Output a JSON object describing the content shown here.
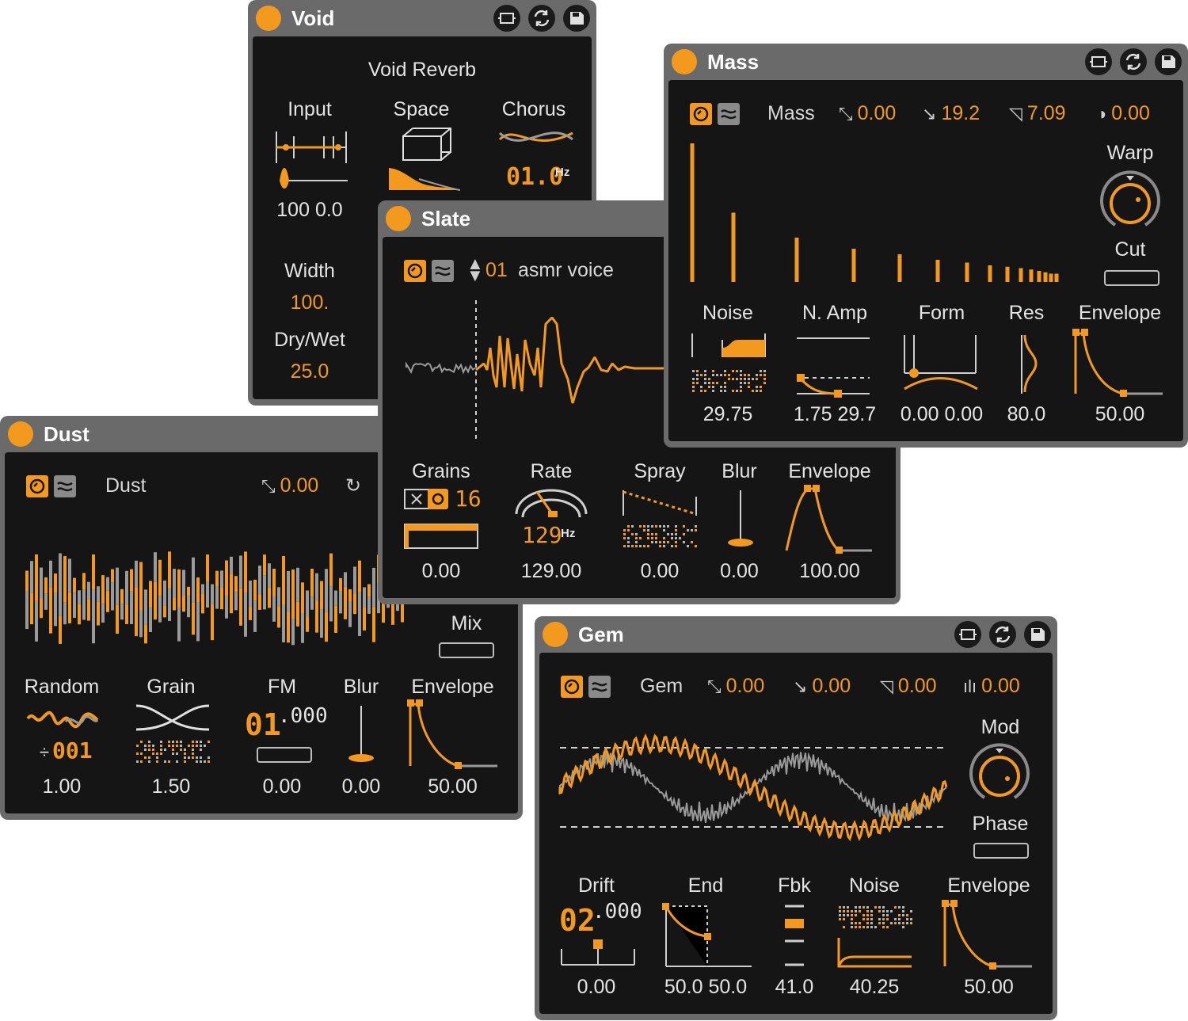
{
  "accent": "#f39a1e",
  "title_buttons": [
    "fold-icon",
    "swap-icon",
    "save-icon"
  ],
  "void": {
    "title": "Void",
    "subtitle": "Void Reverb",
    "labels": {
      "input": "Input",
      "space": "Space",
      "chorus": "Chorus",
      "width": "Width",
      "drywet": "Dry/Wet"
    },
    "input_value": "100 0.0",
    "chorus_rate": "01.0",
    "chorus_unit": "Hz",
    "width_value": "100.",
    "drywet_value": "25.0"
  },
  "mass": {
    "title": "Mass",
    "name": "Mass",
    "params": [
      "0.00",
      "19.2",
      "7.09",
      "0.00"
    ],
    "param_icons": [
      "pitch-icon",
      "decay-icon",
      "attack-icon",
      "contrast-icon"
    ],
    "warp_label": "Warp",
    "cut_label": "Cut",
    "partials": [
      1.0,
      0.5,
      0.32,
      0.24,
      0.2,
      0.16,
      0.14,
      0.12,
      0.11,
      0.1,
      0.09,
      0.08,
      0.07,
      0.06,
      0.06
    ],
    "labels": {
      "noise": "Noise",
      "namp": "N. Amp",
      "form": "Form",
      "res": "Res",
      "envelope": "Envelope"
    },
    "values": {
      "noise": "29.75",
      "namp": "1.75 29.7",
      "form": "0.00 0.00",
      "res": "80.0",
      "envelope": "50.00"
    }
  },
  "slate": {
    "title": "Slate",
    "preset_number": "01",
    "preset_name": "asmr voice",
    "labels": {
      "grains": "Grains",
      "rate": "Rate",
      "spray": "Spray",
      "blur": "Blur",
      "envelope": "Envelope"
    },
    "grains_count": "16",
    "rate_display": "129",
    "rate_unit": "Hz",
    "values": {
      "grains": "0.00",
      "rate": "129.00",
      "spray": "0.00",
      "blur": "0.00",
      "envelope": "100.00"
    }
  },
  "dust": {
    "title": "Dust",
    "name": "Dust",
    "param": "0.00",
    "mix_label": "Mix",
    "labels": {
      "random": "Random",
      "grain": "Grain",
      "fm": "FM",
      "blur": "Blur",
      "envelope": "Envelope"
    },
    "random_display": "001",
    "fm_display_int": "01",
    "fm_display_dec": ".000",
    "values": {
      "random": "1.00",
      "grain": "1.50",
      "fm": "0.00",
      "blur": "0.00",
      "envelope": "50.00"
    }
  },
  "gem": {
    "title": "Gem",
    "name": "Gem",
    "params": [
      "0.00",
      "0.00",
      "0.00",
      "0.00"
    ],
    "param_icons": [
      "pitch-icon",
      "decay-icon",
      "attack-icon",
      "bars-icon"
    ],
    "mod_label": "Mod",
    "phase_label": "Phase",
    "labels": {
      "drift": "Drift",
      "end": "End",
      "fbk": "Fbk",
      "noise": "Noise",
      "envelope": "Envelope"
    },
    "drift_display_int": "02",
    "drift_display_dec": ".000",
    "values": {
      "drift": "0.00",
      "end": "50.0 50.0",
      "fbk": "41.0",
      "noise": "40.25",
      "envelope": "50.00"
    }
  }
}
